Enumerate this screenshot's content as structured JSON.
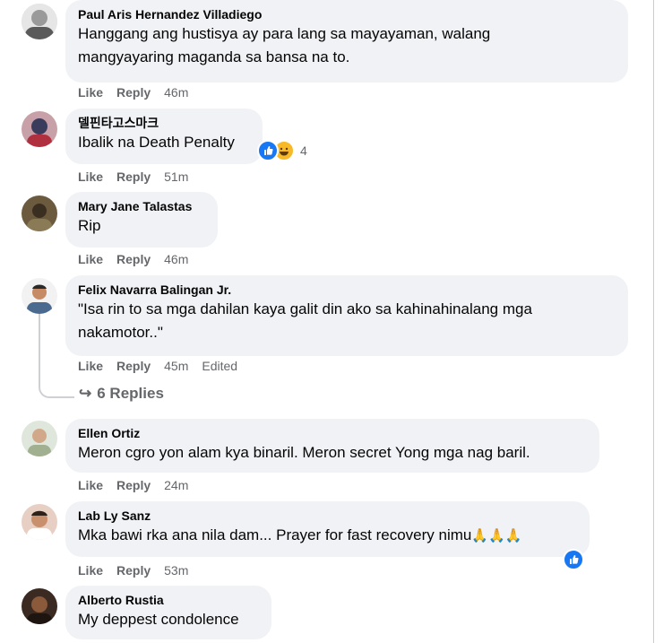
{
  "comments": [
    {
      "author": "Paul Aris Hernandez Villadiego",
      "text": "Hanggang ang hustisya ay para lang sa mayayaman, walang mangyayaring maganda sa bansa na to.",
      "like": "Like",
      "reply": "Reply",
      "time": "46m"
    },
    {
      "author": "델핀타고스마크",
      "text": "Ibalik na Death Penalty",
      "like": "Like",
      "reply": "Reply",
      "time": "51m",
      "reaction_count": "4",
      "reaction_icons": [
        "like-icon",
        "haha-icon"
      ]
    },
    {
      "author": "Mary Jane Talastas",
      "text": "Rip",
      "like": "Like",
      "reply": "Reply",
      "time": "46m"
    },
    {
      "author": "Felix Navarra Balingan Jr.",
      "text": "\"Isa rin to sa mga dahilan kaya galit din ako sa kahinahinalang mga nakamotor..\"",
      "like": "Like",
      "reply": "Reply",
      "time": "45m",
      "edited": "Edited",
      "replies_label": "6 Replies"
    },
    {
      "author": "Ellen Ortiz",
      "text": "Meron cgro yon alam kya binaril. Meron secret Yong mga nag baril.",
      "like": "Like",
      "reply": "Reply",
      "time": "24m"
    },
    {
      "author": "Lab Ly Sanz",
      "text": "Mka bawi rka ana nila dam... Prayer for fast recovery nimu",
      "emoji": "🙏🙏🙏",
      "like": "Like",
      "reply": "Reply",
      "time": "53m",
      "reaction_icons": [
        "like-icon"
      ]
    },
    {
      "author": "Alberto Rustia",
      "text": "My deppest condolence"
    }
  ],
  "colors": {
    "bubble": "#f0f2f5",
    "meta": "#65676b",
    "like_blue": "#1877f2",
    "haha_yellow": "#f7b928"
  }
}
